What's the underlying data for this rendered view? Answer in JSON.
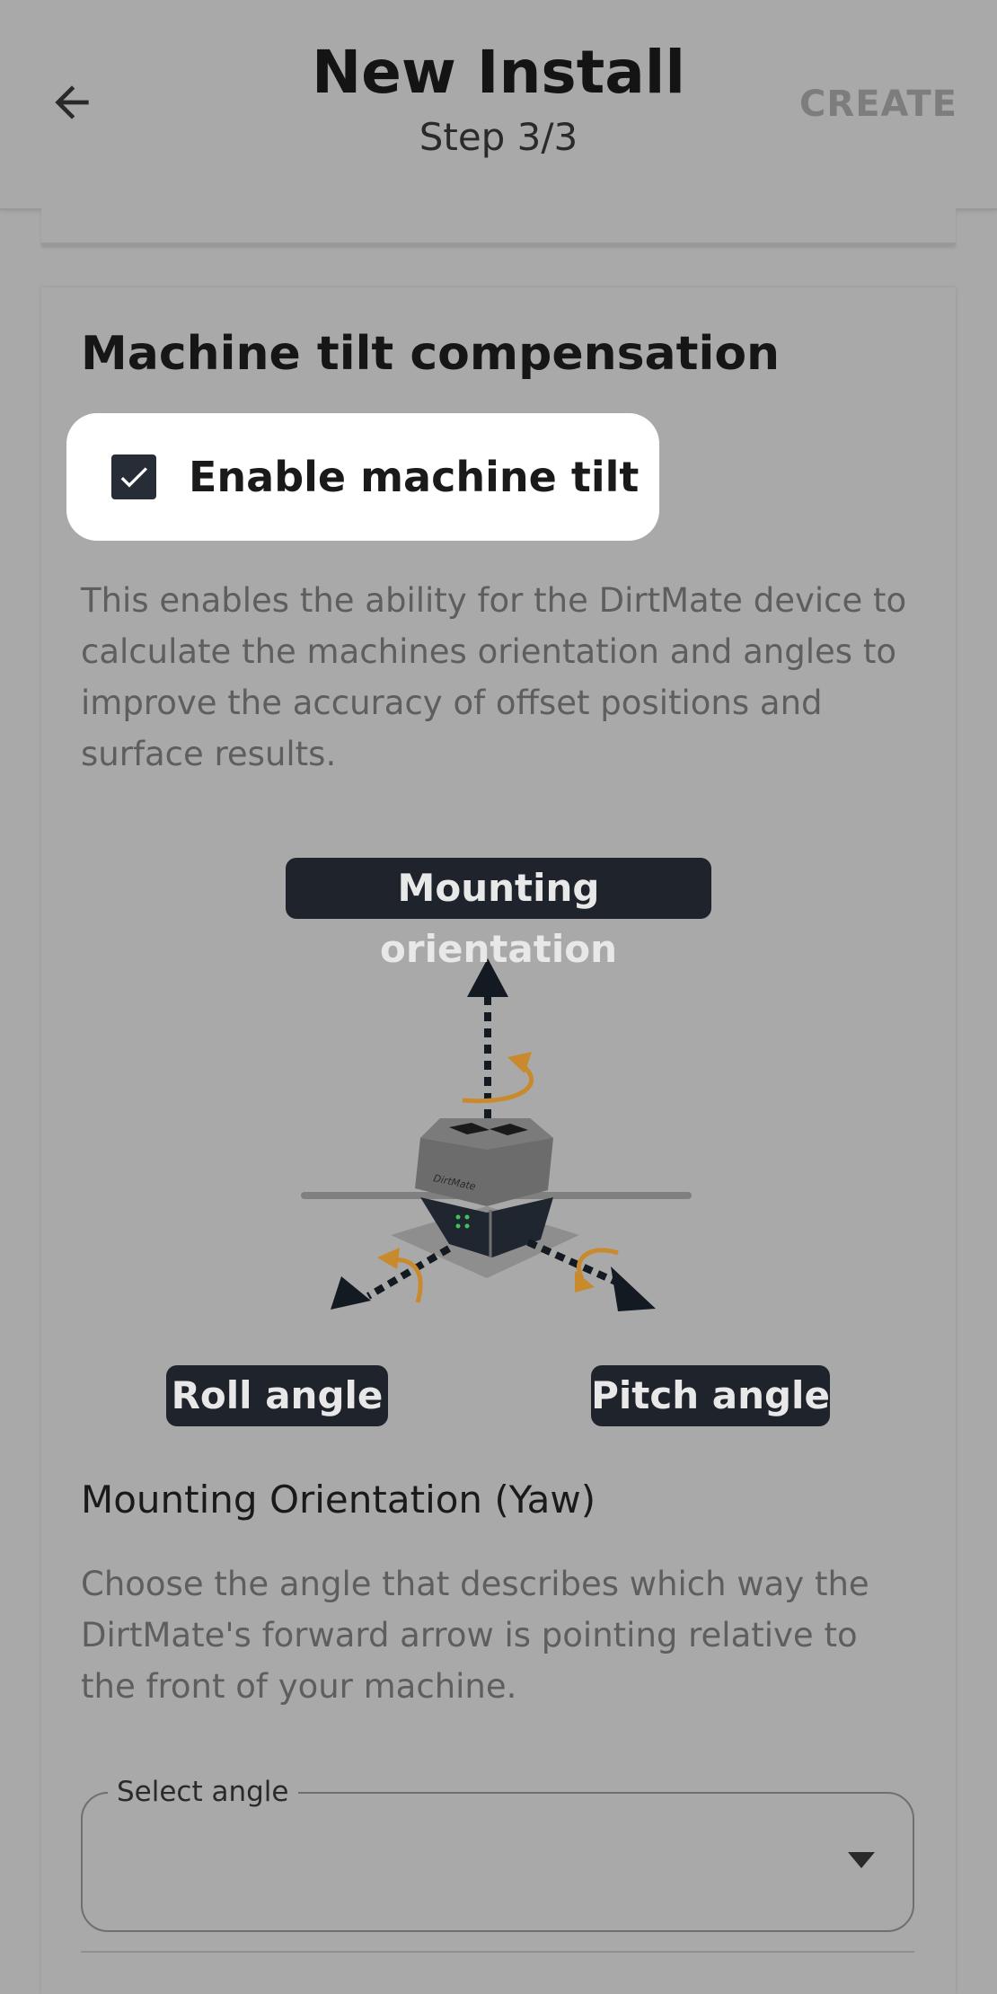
{
  "header": {
    "title": "New Install",
    "subtitle": "Step 3/3",
    "create_label": "CREATE"
  },
  "tilt": {
    "section_title": "Machine tilt compensation",
    "checkbox_label": "Enable machine tilt",
    "checked": true,
    "description": "This enables the ability for the DirtMate device to calculate the machines orientation and angles to improve the accuracy of offset positions and surface results."
  },
  "diagram": {
    "mounting_label": "Mounting orientation",
    "roll_label": "Roll angle",
    "pitch_label": "Pitch angle",
    "device_brand": "DirtMate"
  },
  "yaw": {
    "title": "Mounting Orientation (Yaw)",
    "description": "Choose the angle that describes which way the DirtMate's forward arrow is pointing relative to the front of your machine.",
    "select_label": "Select angle",
    "select_value": ""
  },
  "colors": {
    "background": "#a9a9a9",
    "tag_bg": "#1f242c",
    "accent_orange": "#c98a2e",
    "checkbox": "#272d36"
  }
}
